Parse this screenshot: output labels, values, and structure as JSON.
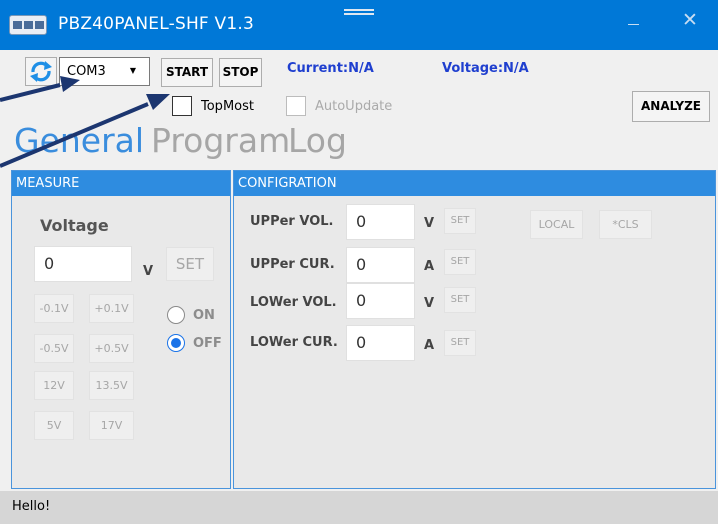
{
  "window": {
    "title": "PBZ40PANEL-SHF V1.3",
    "icon": "app-icon",
    "accent": "#0078d7"
  },
  "toolbar": {
    "com_port": "COM3",
    "start_label": "START",
    "stop_label": "STOP",
    "current_label": "Current:N/A",
    "voltage_label": "Voltage:N/A",
    "topmost_label": "TopMost",
    "topmost_checked": false,
    "autoupdate_label": "AutoUpdate",
    "autoupdate_checked": false,
    "analyze_label": "ANALYZE"
  },
  "tabs": [
    {
      "label": "General",
      "active": true
    },
    {
      "label": "Program",
      "active": false
    },
    {
      "label": "Log",
      "active": false
    }
  ],
  "measure": {
    "header": "MEASURE",
    "title": "Voltage",
    "value": "0",
    "unit": "V",
    "set_label": "SET",
    "step_buttons": [
      "-0.1V",
      "+0.1V",
      "-0.5V",
      "+0.5V",
      "12V",
      "13.5V",
      "5V",
      "17V"
    ],
    "on_label": "ON",
    "off_label": "OFF",
    "output_state": "OFF"
  },
  "config": {
    "header": "CONFIGRATION",
    "rows": [
      {
        "label": "UPPer VOL.",
        "value": "0",
        "unit": "V",
        "set_label": "SET"
      },
      {
        "label": "UPPer CUR.",
        "value": "0",
        "unit": "A",
        "set_label": "SET"
      },
      {
        "label": "LOWer VOL.",
        "value": "0",
        "unit": "V",
        "set_label": "SET"
      },
      {
        "label": "LOWer CUR.",
        "value": "0",
        "unit": "A",
        "set_label": "SET"
      }
    ],
    "local_label": "LOCAL",
    "cls_label": "*CLS"
  },
  "status": {
    "text": "Hello!"
  },
  "colors": {
    "panel_header": "#2e8ce0",
    "readout_text": "#1f3fcf",
    "active_tab": "#3a8ddd",
    "inactive_tab": "#a6a6a6",
    "annotation_arrow": "#1c3670"
  }
}
